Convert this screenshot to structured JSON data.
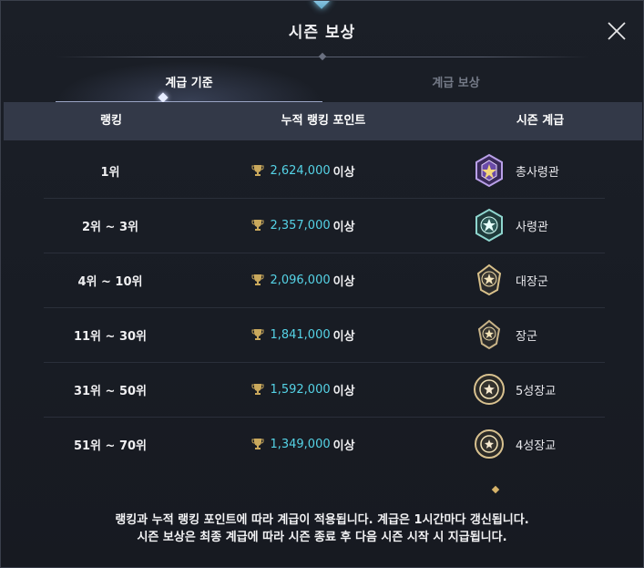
{
  "window": {
    "title": "시즌 보상"
  },
  "tabs": [
    {
      "label": "계급 기준",
      "active": true
    },
    {
      "label": "계급 보상",
      "active": false
    }
  ],
  "table": {
    "headers": {
      "rank": "랭킹",
      "points": "누적 랭킹 포인트",
      "tier": "시즌 계급"
    },
    "rows": [
      {
        "rank": "1위",
        "points": "2,624,000",
        "suffix": "이상",
        "tier": "총사령관",
        "emblem": "supreme-commander-emblem-icon"
      },
      {
        "rank": "2위 ~ 3위",
        "points": "2,357,000",
        "suffix": "이상",
        "tier": "사령관",
        "emblem": "commander-emblem-icon"
      },
      {
        "rank": "4위 ~ 10위",
        "points": "2,096,000",
        "suffix": "이상",
        "tier": "대장군",
        "emblem": "grand-general-emblem-icon"
      },
      {
        "rank": "11위 ~ 30위",
        "points": "1,841,000",
        "suffix": "이상",
        "tier": "장군",
        "emblem": "general-emblem-icon"
      },
      {
        "rank": "31위 ~ 50위",
        "points": "1,592,000",
        "suffix": "이상",
        "tier": "5성장교",
        "emblem": "five-star-officer-emblem-icon"
      },
      {
        "rank": "51위 ~ 70위",
        "points": "1,349,000",
        "suffix": "이상",
        "tier": "4성장교",
        "emblem": "four-star-officer-emblem-icon"
      }
    ]
  },
  "footer": {
    "line1": "랭킹과 누적 랭킹 포인트에 따라 계급이 적용됩니다. 계급은 1시간마다 갱신됩니다.",
    "line2": "시즌 보상은 최종 계급에 따라 시즌 종료 후 다음 시즌 시작 시 지급됩니다."
  },
  "colors": {
    "points": "#55d3e6",
    "header_bg": "#333948",
    "background": "#1b1f27",
    "trophy": "#c9a85c"
  }
}
